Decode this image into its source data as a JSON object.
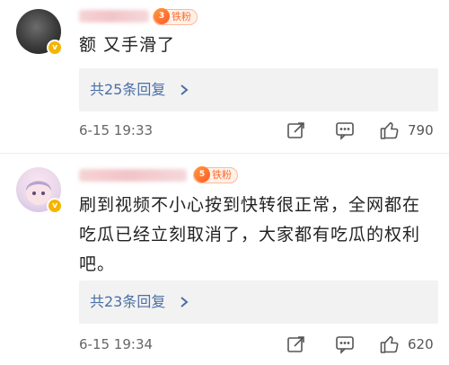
{
  "comments": [
    {
      "fan_badge": {
        "level": "3",
        "label": "铁粉"
      },
      "text": "额 又手滑了",
      "replies_label": "共25条回复",
      "time": "6-15 19:33",
      "like_count": "790"
    },
    {
      "fan_badge": {
        "level": "5",
        "label": "铁粉"
      },
      "text": "刷到视频不小心按到快转很正常，全网都在吃瓜已经立刻取消了，大家都有吃瓜的权利吧。",
      "replies_label": "共23条回复",
      "time": "6-15 19:34",
      "like_count": "620"
    }
  ],
  "icons": {
    "share": "share-icon",
    "comment": "comment-icon",
    "like": "thumbs-up-icon",
    "chevron": "chevron-right-icon",
    "vip": "vip-badge-icon"
  },
  "colors": {
    "link": "#4a6fa5",
    "badge_accent": "#ff6a2e",
    "vip": "#f5b400",
    "reply_bg": "#f2f2f2"
  }
}
